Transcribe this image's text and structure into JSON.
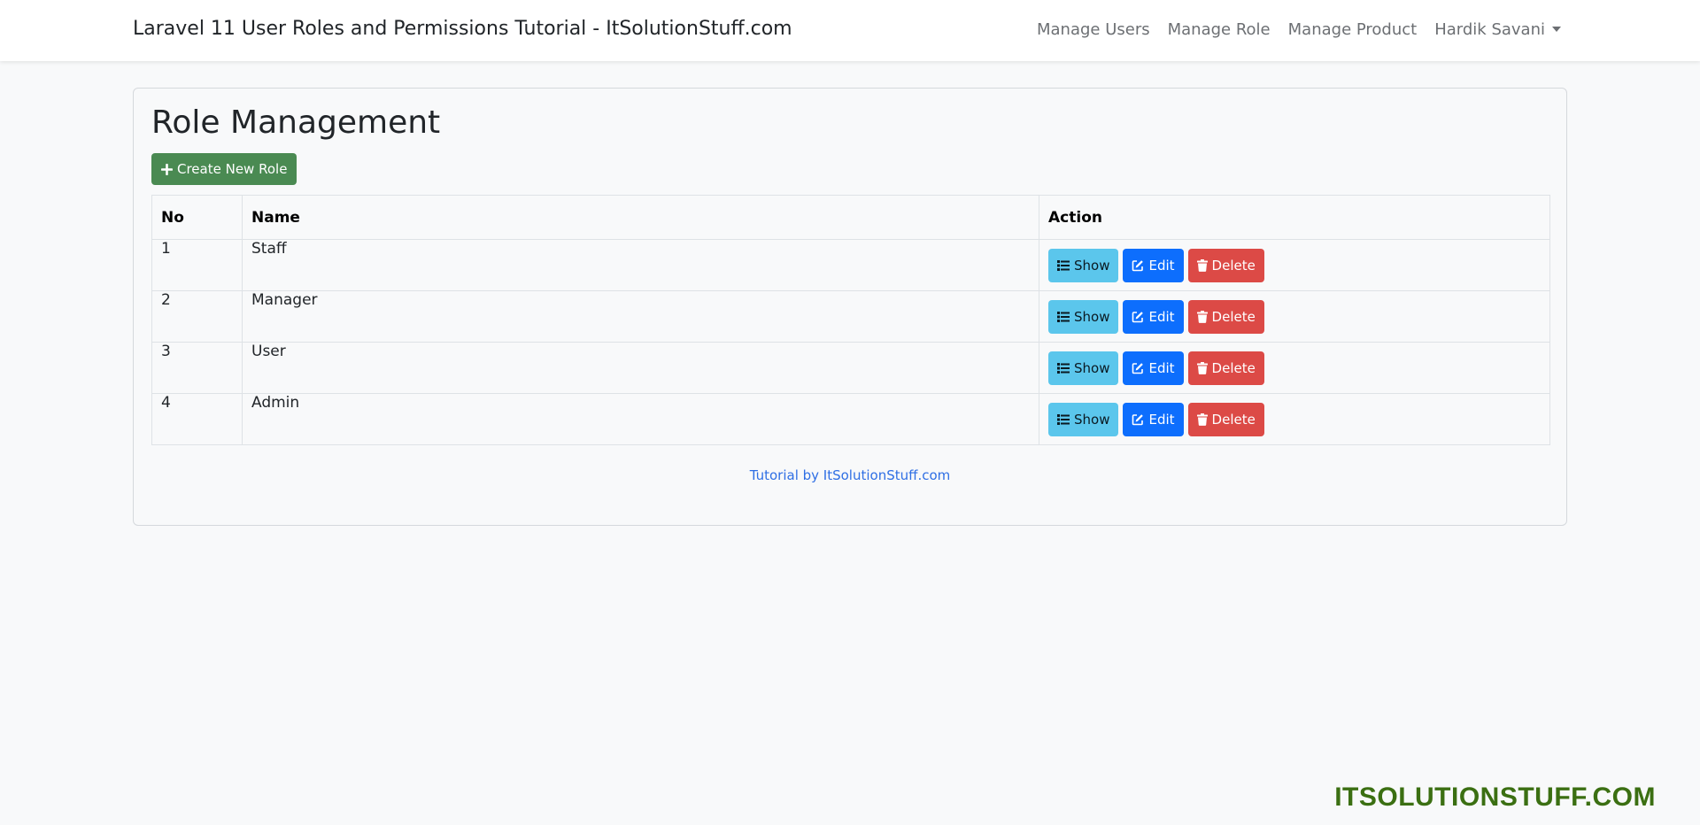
{
  "navbar": {
    "brand": "Laravel 11 User Roles and Permissions Tutorial - ItSolutionStuff.com",
    "links": [
      {
        "label": "Manage Users"
      },
      {
        "label": "Manage Role"
      },
      {
        "label": "Manage Product"
      }
    ],
    "user": {
      "label": "Hardik Savani"
    }
  },
  "main": {
    "title": "Role Management",
    "create_button": "Create New Role",
    "table": {
      "headers": [
        "No",
        "Name",
        "Action"
      ],
      "rows": [
        {
          "no": "1",
          "name": "Staff"
        },
        {
          "no": "2",
          "name": "Manager"
        },
        {
          "no": "3",
          "name": "User"
        },
        {
          "no": "4",
          "name": "Admin"
        }
      ],
      "actions": {
        "show": "Show",
        "edit": "Edit",
        "delete": "Delete"
      }
    },
    "footer": "Tutorial by ItSolutionStuff.com"
  },
  "watermark": "ITSOLUTIONSTUFF.COM",
  "colors": {
    "create": "#4a8a52",
    "show": "#5bc6ec",
    "edit": "#0d6efd",
    "delete": "#dc4a46",
    "link": "#2f6fe4",
    "watermark": "#3b6f12"
  }
}
